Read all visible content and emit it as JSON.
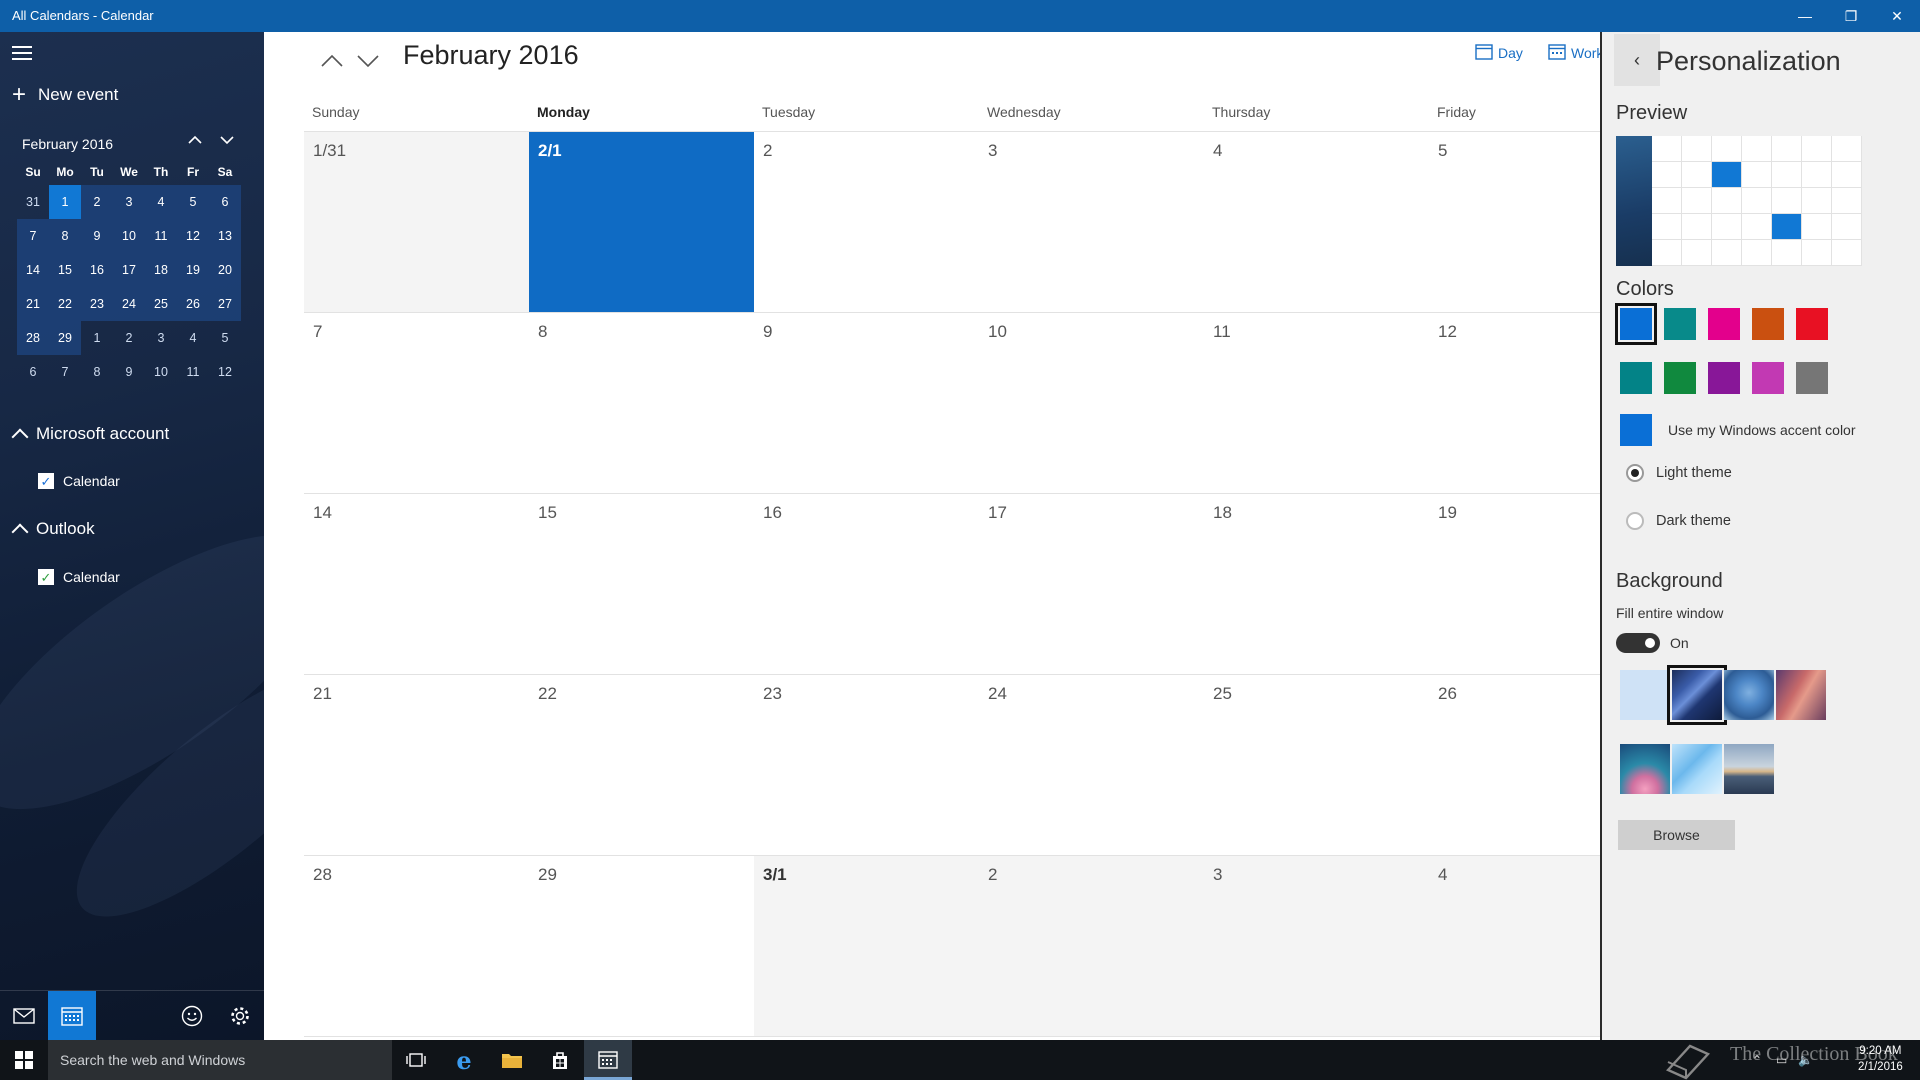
{
  "window": {
    "title": "All Calendars - Calendar",
    "controls": {
      "minimize": "—",
      "restore": "❐",
      "close": "✕"
    }
  },
  "sidebar": {
    "new_event": "New event",
    "mini_calendar": {
      "title": "February 2016",
      "weekday_headers": [
        "Su",
        "Mo",
        "Tu",
        "We",
        "Th",
        "Fr",
        "Sa"
      ],
      "weeks": [
        [
          "31",
          "1",
          "2",
          "3",
          "4",
          "5",
          "6"
        ],
        [
          "7",
          "8",
          "9",
          "10",
          "11",
          "12",
          "13"
        ],
        [
          "14",
          "15",
          "16",
          "17",
          "18",
          "19",
          "20"
        ],
        [
          "21",
          "22",
          "23",
          "24",
          "25",
          "26",
          "27"
        ],
        [
          "28",
          "29",
          "1",
          "2",
          "3",
          "4",
          "5"
        ],
        [
          "6",
          "7",
          "8",
          "9",
          "10",
          "11",
          "12"
        ]
      ],
      "selected": "1"
    },
    "accounts": [
      {
        "name": "Microsoft account",
        "calendar": "Calendar",
        "color": "#1a6fd6"
      },
      {
        "name": "Outlook",
        "calendar": "Calendar",
        "color": "#2e9e3e"
      }
    ]
  },
  "main": {
    "month_title": "February 2016",
    "view_day": "Day",
    "view_work": "Work",
    "day_headers": [
      "Sunday",
      "Monday",
      "Tuesday",
      "Wednesday",
      "Thursday",
      "Friday"
    ],
    "weeks": [
      [
        "1/31",
        "2/1",
        "2",
        "3",
        "4",
        "5"
      ],
      [
        "7",
        "8",
        "9",
        "10",
        "11",
        "12"
      ],
      [
        "14",
        "15",
        "16",
        "17",
        "18",
        "19"
      ],
      [
        "21",
        "22",
        "23",
        "24",
        "25",
        "26"
      ],
      [
        "28",
        "29",
        "3/1",
        "2",
        "3",
        "4"
      ]
    ]
  },
  "personalization": {
    "back_icon": "‹",
    "title": "Personalization",
    "preview_label": "Preview",
    "colors_label": "Colors",
    "colors": [
      "#0a6fd6",
      "#088a8a",
      "#e3008c",
      "#ca5010",
      "#e81123",
      "#038387",
      "#10893e",
      "#881798",
      "#c239b3",
      "#767676"
    ],
    "accent_label": "Use my Windows accent color",
    "light_theme": "Light theme",
    "dark_theme": "Dark theme",
    "background_label": "Background",
    "fill_label": "Fill entire window",
    "toggle_state": "On",
    "browse_label": "Browse"
  },
  "taskbar": {
    "search_placeholder": "Search the web and Windows",
    "watermark": "The Collection Book",
    "time": "9:20 AM",
    "date": "2/1/2016"
  }
}
